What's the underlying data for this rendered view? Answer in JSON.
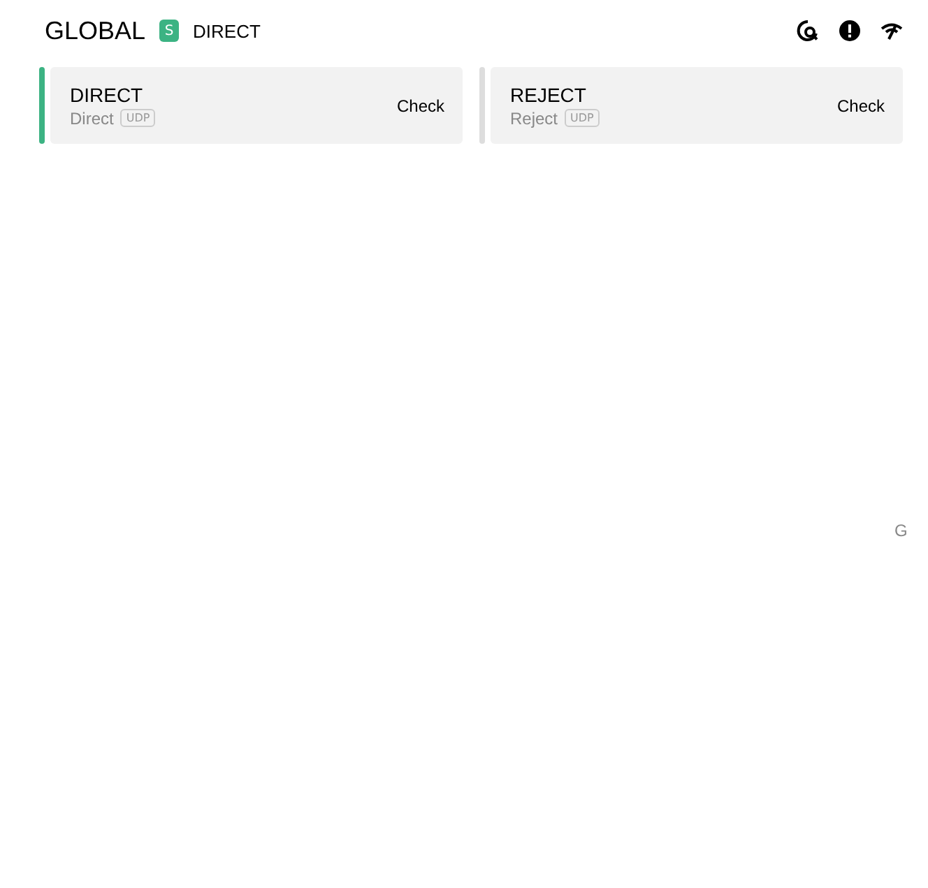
{
  "header": {
    "title": "GLOBAL",
    "badge": "S",
    "current": "DIRECT"
  },
  "proxies": [
    {
      "name": "DIRECT",
      "type": "Direct",
      "tag": "UDP",
      "action": "Check",
      "selected": true
    },
    {
      "name": "REJECT",
      "type": "Reject",
      "tag": "UDP",
      "action": "Check",
      "selected": false
    }
  ],
  "index_letter": "G"
}
